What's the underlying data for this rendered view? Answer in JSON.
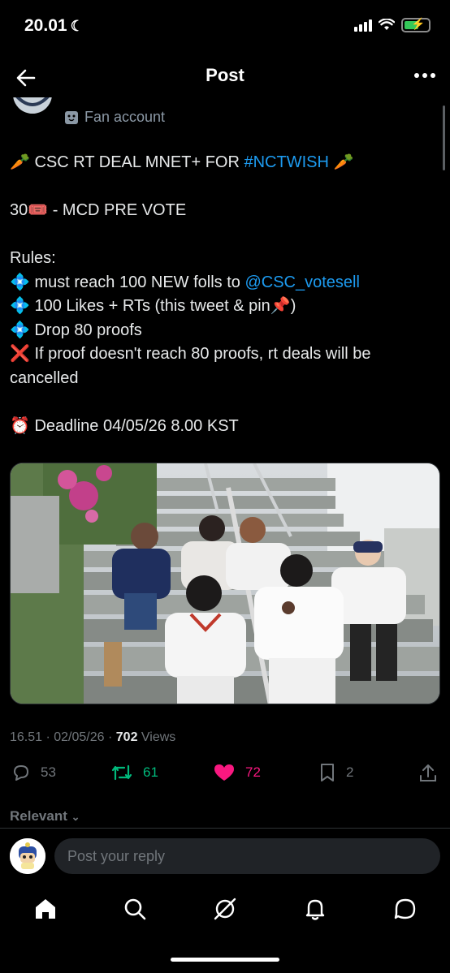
{
  "status_bar": {
    "time": "20.01",
    "battery_color": "#34c759"
  },
  "header": {
    "title": "Post"
  },
  "author": {
    "role": "Fan account"
  },
  "tweet": {
    "line1_pre": "CSC RT DEAL MNET+ FOR ",
    "line1_hashtag": "#NCTWISH",
    "line2": "30",
    "line2_rest": " - MCD PRE VOTE",
    "rules_label": "Rules:",
    "rule1_pre": "must reach 100 NEW folls to ",
    "rule1_mention": "@CSC_votesell",
    "rule2": "100 Likes + RTs (this tweet & pin",
    "rule2_end": ")",
    "rule3": "Drop 80 proofs",
    "rule4": "If proof doesn't reach 80 proofs, rt deals will be cancelled",
    "deadline": "Deadline 04/05/26 8.00 KST"
  },
  "meta": {
    "timestamp": "16.51 · 02/05/26 · ",
    "views_count": "702",
    "views_label": " Views"
  },
  "actions": {
    "replies": "53",
    "reposts": "61",
    "likes": "72",
    "bookmarks": "2"
  },
  "colors": {
    "accent": "#1d9bf0",
    "repost": "#00ba7c",
    "like": "#f91880",
    "muted": "#71767b"
  },
  "replies_filter": {
    "label": "Relevant"
  },
  "reply_box": {
    "placeholder": "Post your reply"
  },
  "bottom_nav": [
    "home-icon",
    "search-icon",
    "grok-icon",
    "bell-icon",
    "messages-icon"
  ]
}
